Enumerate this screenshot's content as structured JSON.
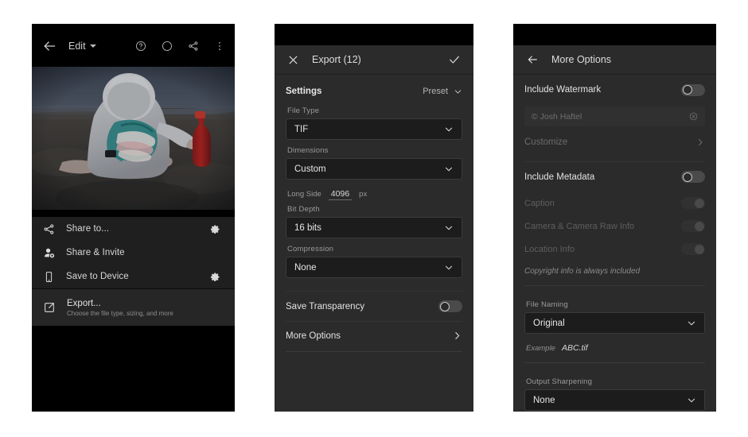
{
  "panels": {
    "edit": {
      "topbar": {
        "back_icon": "arrow-left-icon",
        "title": "Edit",
        "help_icon": "help-circle-icon",
        "circle_icon": "circle-icon",
        "share_icon": "share-icon",
        "overflow_icon": "more-vertical-icon"
      },
      "photo": {
        "alt": "Toddler in white hoodie sitting on a beach at dusk holding a red bottle"
      },
      "menu": [
        {
          "icon": "share-icon",
          "label": "Share to...",
          "trailing_icon": "gear-icon"
        },
        {
          "icon": "person-add-icon",
          "label": "Share & Invite",
          "trailing_icon": ""
        },
        {
          "icon": "phone-icon",
          "label": "Save to Device",
          "trailing_icon": "gear-icon"
        }
      ],
      "export": {
        "icon": "export-icon",
        "title": "Export...",
        "subtitle": "Choose the file type, sizing, and more"
      }
    },
    "export": {
      "header": {
        "close_icon": "close-icon",
        "title": "Export (12)",
        "confirm_icon": "check-icon"
      },
      "settings": {
        "label": "Settings",
        "preset_label": "Preset",
        "preset_caret": "chevron-down-icon"
      },
      "fields": [
        {
          "label": "File Type",
          "value": "TIF"
        },
        {
          "label": "Dimensions",
          "value": "Custom"
        }
      ],
      "long_side": {
        "label": "Long Side",
        "value": "4096",
        "unit": "px"
      },
      "fields2": [
        {
          "label": "Bit Depth",
          "value": "16 bits"
        },
        {
          "label": "Compression",
          "value": "None"
        }
      ],
      "save_transparency": {
        "label": "Save Transparency",
        "state": "off"
      },
      "more_options": {
        "label": "More Options",
        "chevron": "chevron-right-icon"
      }
    },
    "more": {
      "header": {
        "back_icon": "arrow-left-icon",
        "title": "More Options"
      },
      "watermark": {
        "label": "Include Watermark",
        "state": "off",
        "input_value": "© Josh Haftel",
        "clear_icon": "clear-circle-icon",
        "customize_label": "Customize",
        "customize_chevron": "chevron-right-icon"
      },
      "metadata": {
        "label": "Include Metadata",
        "state": "off",
        "sub_items": [
          {
            "label": "Caption",
            "state": "on-disabled"
          },
          {
            "label": "Camera & Camera Raw Info",
            "state": "on-disabled"
          },
          {
            "label": "Location Info",
            "state": "on-disabled"
          }
        ],
        "note": "Copyright info is always included"
      },
      "file_naming": {
        "label": "File Naming",
        "value": "Original"
      },
      "example": {
        "label": "Example",
        "value": "ABC.tif"
      },
      "output_sharpening": {
        "label": "Output Sharpening",
        "value": "None"
      }
    }
  },
  "colors": {
    "page_background": "#ffffff",
    "panel_background": "#2b2b2b",
    "statusbar": "#000000",
    "field_background": "#1c1c1c",
    "text_primary": "#e6e6e6",
    "text_secondary": "#9a9a9a",
    "text_disabled": "#5e5e5e"
  }
}
